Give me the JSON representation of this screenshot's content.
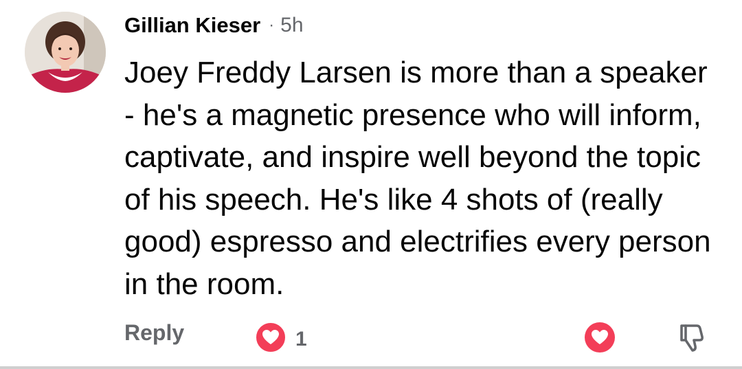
{
  "comment": {
    "author": "Gillian Kieser",
    "separator": "·",
    "time": "5h",
    "text": "Joey Freddy Larsen is more than a speaker - he's a magnetic presence who will inform, captivate, and inspire well beyond the topic of his speech. He's like 4 shots of (really good) espresso and electrifies every person in the room."
  },
  "actions": {
    "reply_label": "Reply",
    "reaction_icon": "heart-icon",
    "reaction_count": "1",
    "like_icon": "heart-icon",
    "dislike_icon": "thumbs-down-icon"
  },
  "colors": {
    "text": "#050505",
    "secondary": "#65676b",
    "heart": "#f33e58"
  }
}
